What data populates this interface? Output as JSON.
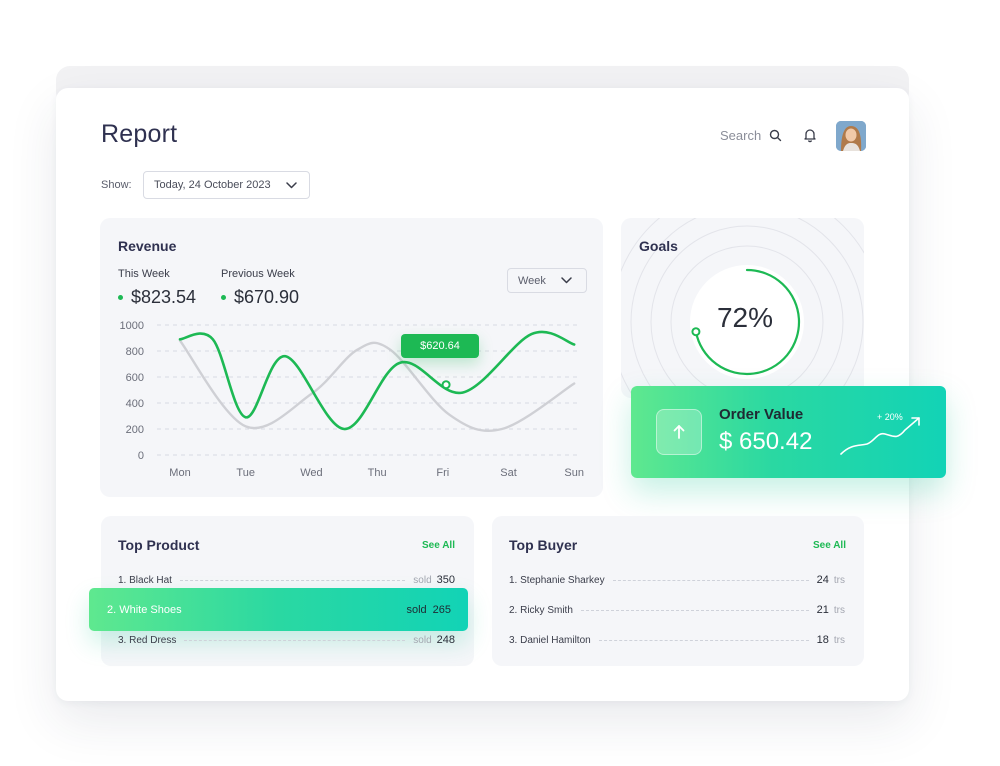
{
  "page": {
    "title": "Report"
  },
  "header": {
    "search_label": "Search"
  },
  "filter": {
    "show_label": "Show:",
    "date": "Today, 24 October 2023"
  },
  "revenue": {
    "title": "Revenue",
    "this_week_label": "This Week",
    "this_week_value": "$823.54",
    "prev_week_label": "Previous Week",
    "prev_week_value": "$670.90",
    "period_select": "Week",
    "tooltip": "$620.64"
  },
  "chart_data": {
    "type": "line",
    "categories": [
      "Mon",
      "Tue",
      "Wed",
      "Thu",
      "Fri",
      "Sat",
      "Sun"
    ],
    "y_ticks": [
      "1000",
      "800",
      "600",
      "400",
      "200",
      "0"
    ],
    "ylim": [
      0,
      1000
    ],
    "grid": true,
    "series": [
      {
        "color": "#1db954",
        "x": [
          0,
          0.5,
          1,
          1.6,
          2.5,
          3.35,
          4.3,
          5.35,
          6
        ],
        "y": [
          890,
          890,
          290,
          760,
          200,
          710,
          480,
          930,
          850
        ]
      },
      {
        "color": "#cfd0d5",
        "x": [
          0,
          1,
          2,
          2.7,
          3.2,
          4.1,
          4.9,
          6
        ],
        "y": [
          880,
          220,
          470,
          810,
          810,
          310,
          200,
          550
        ]
      }
    ],
    "highlight_x": 4.05
  },
  "goals": {
    "title": "Goals",
    "percent": "72%",
    "progress": 0.72
  },
  "order": {
    "title": "Order Value",
    "value": "$ 650.42",
    "growth": "+ 20%"
  },
  "top_product": {
    "title": "Top Product",
    "see_all": "See All",
    "unit": "sold",
    "items": [
      {
        "label": "1. Black Hat",
        "value": "350"
      },
      {
        "label": "2. White Shoes",
        "value": "265"
      },
      {
        "label": "3. Red Dress",
        "value": "248"
      }
    ]
  },
  "top_buyer": {
    "title": "Top Buyer",
    "see_all": "See All",
    "unit": "trs",
    "items": [
      {
        "label": "1. Stephanie Sharkey",
        "value": "24"
      },
      {
        "label": "2. Ricky Smith",
        "value": "21"
      },
      {
        "label": "3. Daniel Hamilton",
        "value": "18"
      }
    ]
  },
  "colors": {
    "accent": "#1db954",
    "accent_gradient_start": "#5fe88f",
    "accent_gradient_end": "#12d3b6",
    "title": "#2f3150"
  }
}
